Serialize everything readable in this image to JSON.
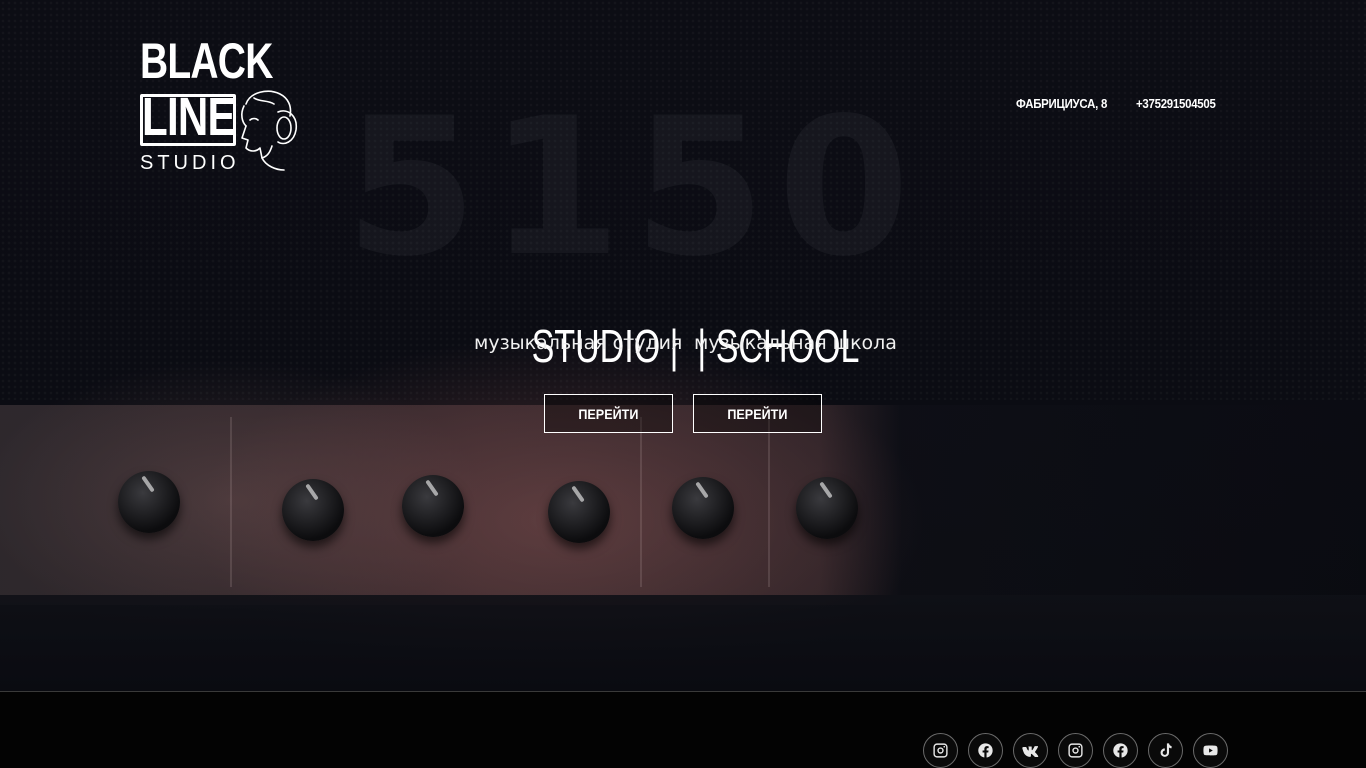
{
  "header": {
    "logo": {
      "line1": "BLACK",
      "line2": "LINE",
      "line3": "STUDIO"
    },
    "address": "ФАБРИЦИУСА, 8",
    "phone": "+375291504505"
  },
  "hero": {
    "background_text": [
      "5",
      "1",
      "5",
      "0"
    ],
    "title": "STUDIO |  | SCHOOL",
    "studio_subtitle": "музыкальная студия",
    "school_subtitle": "музыкальная школа",
    "studio_button_label": "ПЕРЕЙТИ",
    "school_button_label": "ПЕРЕЙТИ"
  },
  "footer": {
    "socials": [
      {
        "icon": "instagram-icon"
      },
      {
        "icon": "facebook-icon"
      },
      {
        "icon": "vk-icon"
      },
      {
        "icon": "instagram-icon"
      },
      {
        "icon": "facebook-icon"
      },
      {
        "icon": "tiktok-icon"
      },
      {
        "icon": "youtube-icon"
      }
    ]
  },
  "colors": {
    "background": "#000000",
    "text": "#ffffff",
    "footer_border": "#3a3a3a",
    "social_border": "#6a6a6a"
  }
}
